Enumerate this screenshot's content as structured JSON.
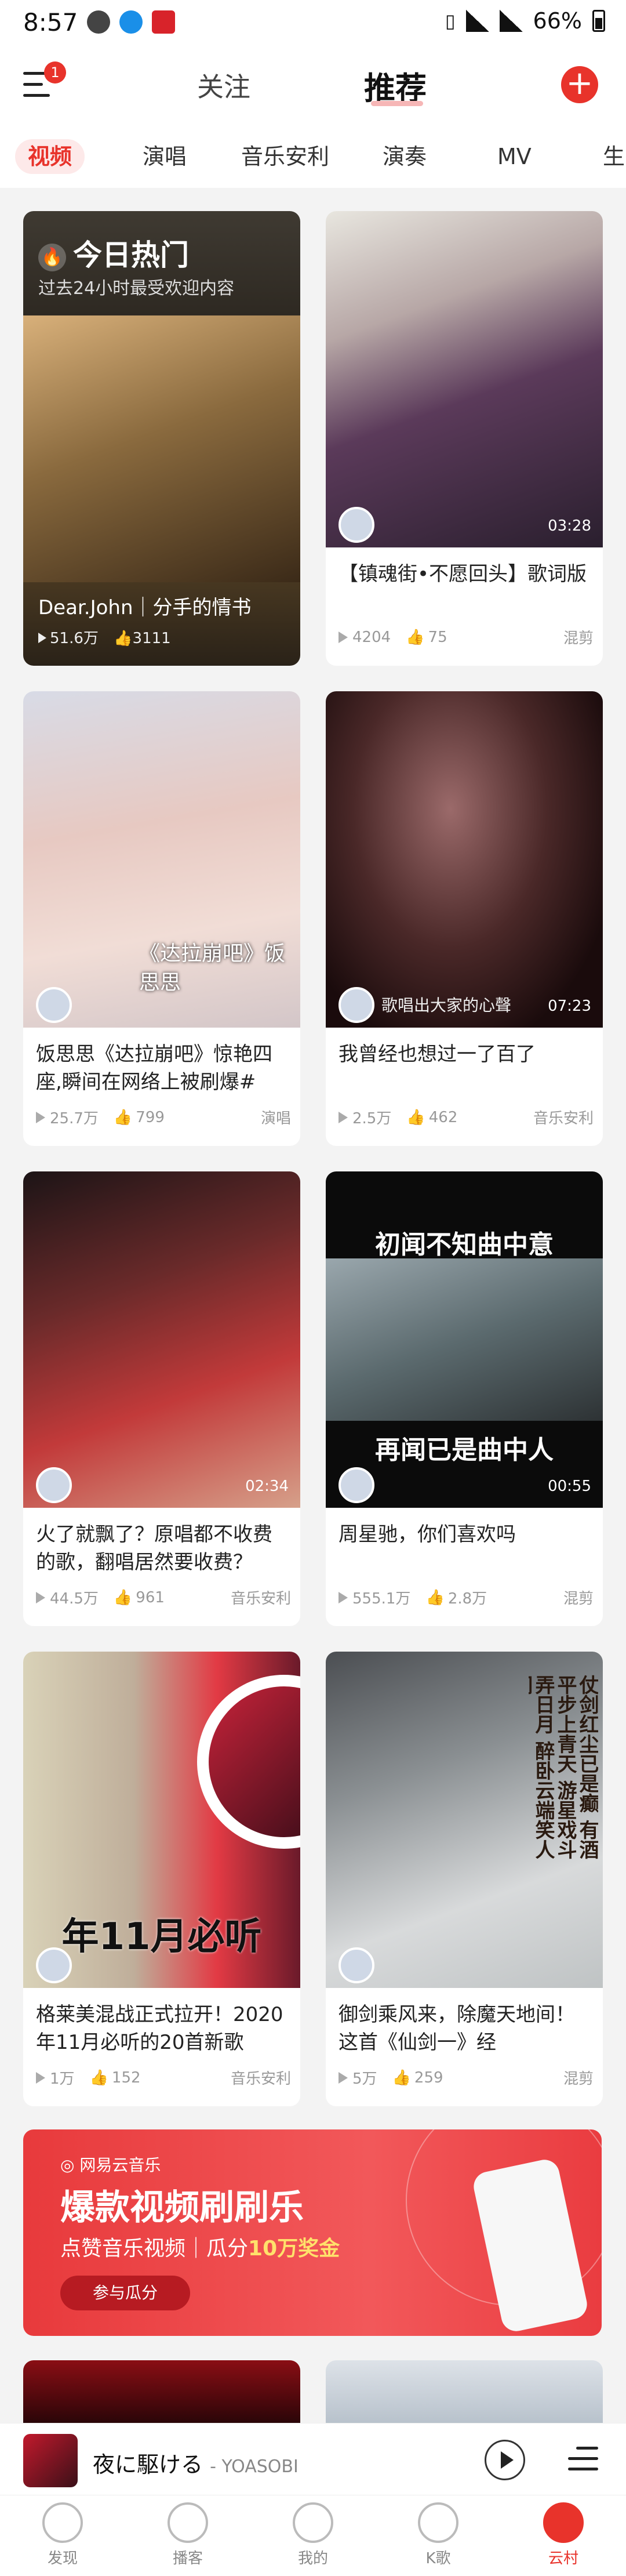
{
  "status_bar": {
    "time": "8:57",
    "battery": "66%",
    "network": "4G"
  },
  "top_nav": {
    "menu_badge": "1",
    "tab_follow": "关注",
    "tab_recommend": "推荐",
    "add_icon": "plus-icon"
  },
  "categories": [
    "视频",
    "演唱",
    "音乐安利",
    "演奏",
    "MV",
    "生"
  ],
  "hot_card": {
    "heading": "今日热门",
    "subheading": "过去24小时最受欢迎内容",
    "title": "Dear.John｜分手的情书",
    "plays": "51.6万",
    "likes": "3111"
  },
  "cards": [
    {
      "title": "【镇魂街•不愿回头】歌词版",
      "duration": "03:28",
      "plays": "4204",
      "likes": "75",
      "tag": "混剪"
    },
    {
      "title": "饭思思《达拉崩吧》惊艳四座,瞬间在网络上被刷爆#今...",
      "overlay": "《达拉崩吧》饭思思",
      "plays": "25.7万",
      "likes": "799",
      "tag": "演唱"
    },
    {
      "title": "我曾经也想过一了百了",
      "overlay": "歌唱出大家的心聲",
      "duration": "07:23",
      "plays": "2.5万",
      "likes": "462",
      "tag": "音乐安利"
    },
    {
      "title": "火了就飘了？原唱都不收费的歌，翻唱居然要收费？",
      "duration": "02:34",
      "plays": "44.5万",
      "likes": "961",
      "tag": "音乐安利"
    },
    {
      "title": "周星驰，你们喜欢吗",
      "overlay_top": "初闻不知曲中意",
      "overlay_bottom": "再闻已是曲中人",
      "duration": "00:55",
      "plays": "555.1万",
      "likes": "2.8万",
      "tag": "混剪"
    },
    {
      "title": "格莱美混战正式拉开！2020年11月必听的20首新歌",
      "overlay": "年11月必听",
      "plays": "1万",
      "likes": "152",
      "tag": "音乐安利"
    },
    {
      "title": "御剑乘风来，除魔天地间！这首《仙剑一》经",
      "overlay_poem": "仗剑红尘已是癫 有酒平步上青天 游星戏斗弄日月 醉卧云端笑人间",
      "plays": "5万",
      "likes": "259",
      "tag": "混剪"
    }
  ],
  "promo": {
    "brand": "网易云音乐",
    "headline": "爆款视频刷刷乐",
    "sub_prefix": "点赞音乐视频｜瓜分",
    "sub_highlight": "10万奖金",
    "cta": "参与瓜分"
  },
  "player": {
    "song": "夜に駆ける",
    "artist": "- YOASOBI"
  },
  "tabbar": [
    "发现",
    "播客",
    "我的",
    "K歌",
    "云村"
  ],
  "colors": {
    "accent": "#e8332b",
    "background": "#f3f3f3"
  }
}
